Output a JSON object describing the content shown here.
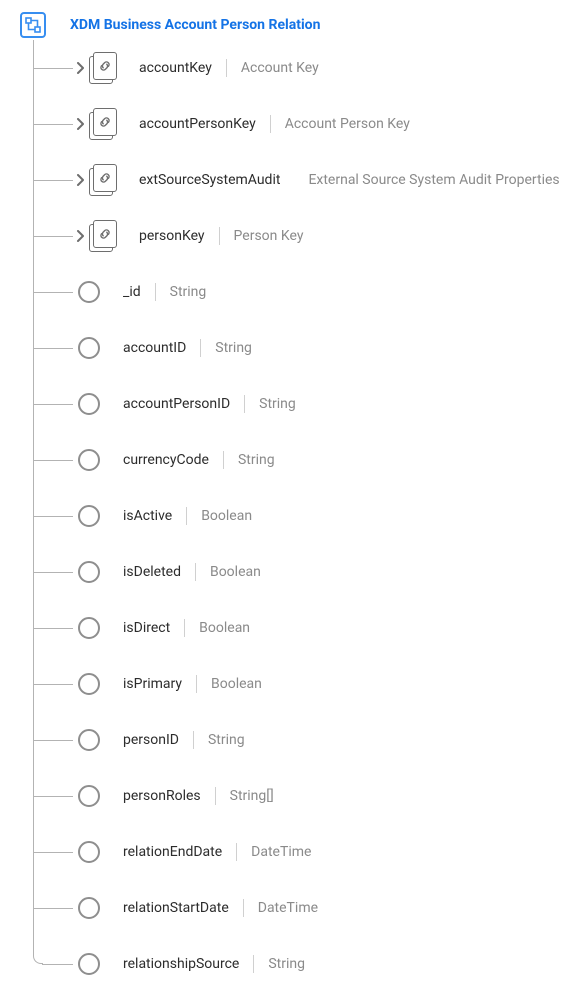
{
  "root": {
    "title": "XDM Business Account Person Relation"
  },
  "fields": [
    {
      "kind": "object",
      "name": "accountKey",
      "desc": "Account Key"
    },
    {
      "kind": "object",
      "name": "accountPersonKey",
      "desc": "Account Person Key"
    },
    {
      "kind": "object",
      "name": "extSourceSystemAudit",
      "desc": "External Source System Audit Properties"
    },
    {
      "kind": "object",
      "name": "personKey",
      "desc": "Person Key"
    },
    {
      "kind": "leaf",
      "name": "_id",
      "desc": "String"
    },
    {
      "kind": "leaf",
      "name": "accountID",
      "desc": "String"
    },
    {
      "kind": "leaf",
      "name": "accountPersonID",
      "desc": "String"
    },
    {
      "kind": "leaf",
      "name": "currencyCode",
      "desc": "String"
    },
    {
      "kind": "leaf",
      "name": "isActive",
      "desc": "Boolean"
    },
    {
      "kind": "leaf",
      "name": "isDeleted",
      "desc": "Boolean"
    },
    {
      "kind": "leaf",
      "name": "isDirect",
      "desc": "Boolean"
    },
    {
      "kind": "leaf",
      "name": "isPrimary",
      "desc": "Boolean"
    },
    {
      "kind": "leaf",
      "name": "personID",
      "desc": "String"
    },
    {
      "kind": "leaf",
      "name": "personRoles",
      "desc": "String[]"
    },
    {
      "kind": "leaf",
      "name": "relationEndDate",
      "desc": "DateTime"
    },
    {
      "kind": "leaf",
      "name": "relationStartDate",
      "desc": "DateTime"
    },
    {
      "kind": "leaf",
      "name": "relationshipSource",
      "desc": "String"
    }
  ]
}
